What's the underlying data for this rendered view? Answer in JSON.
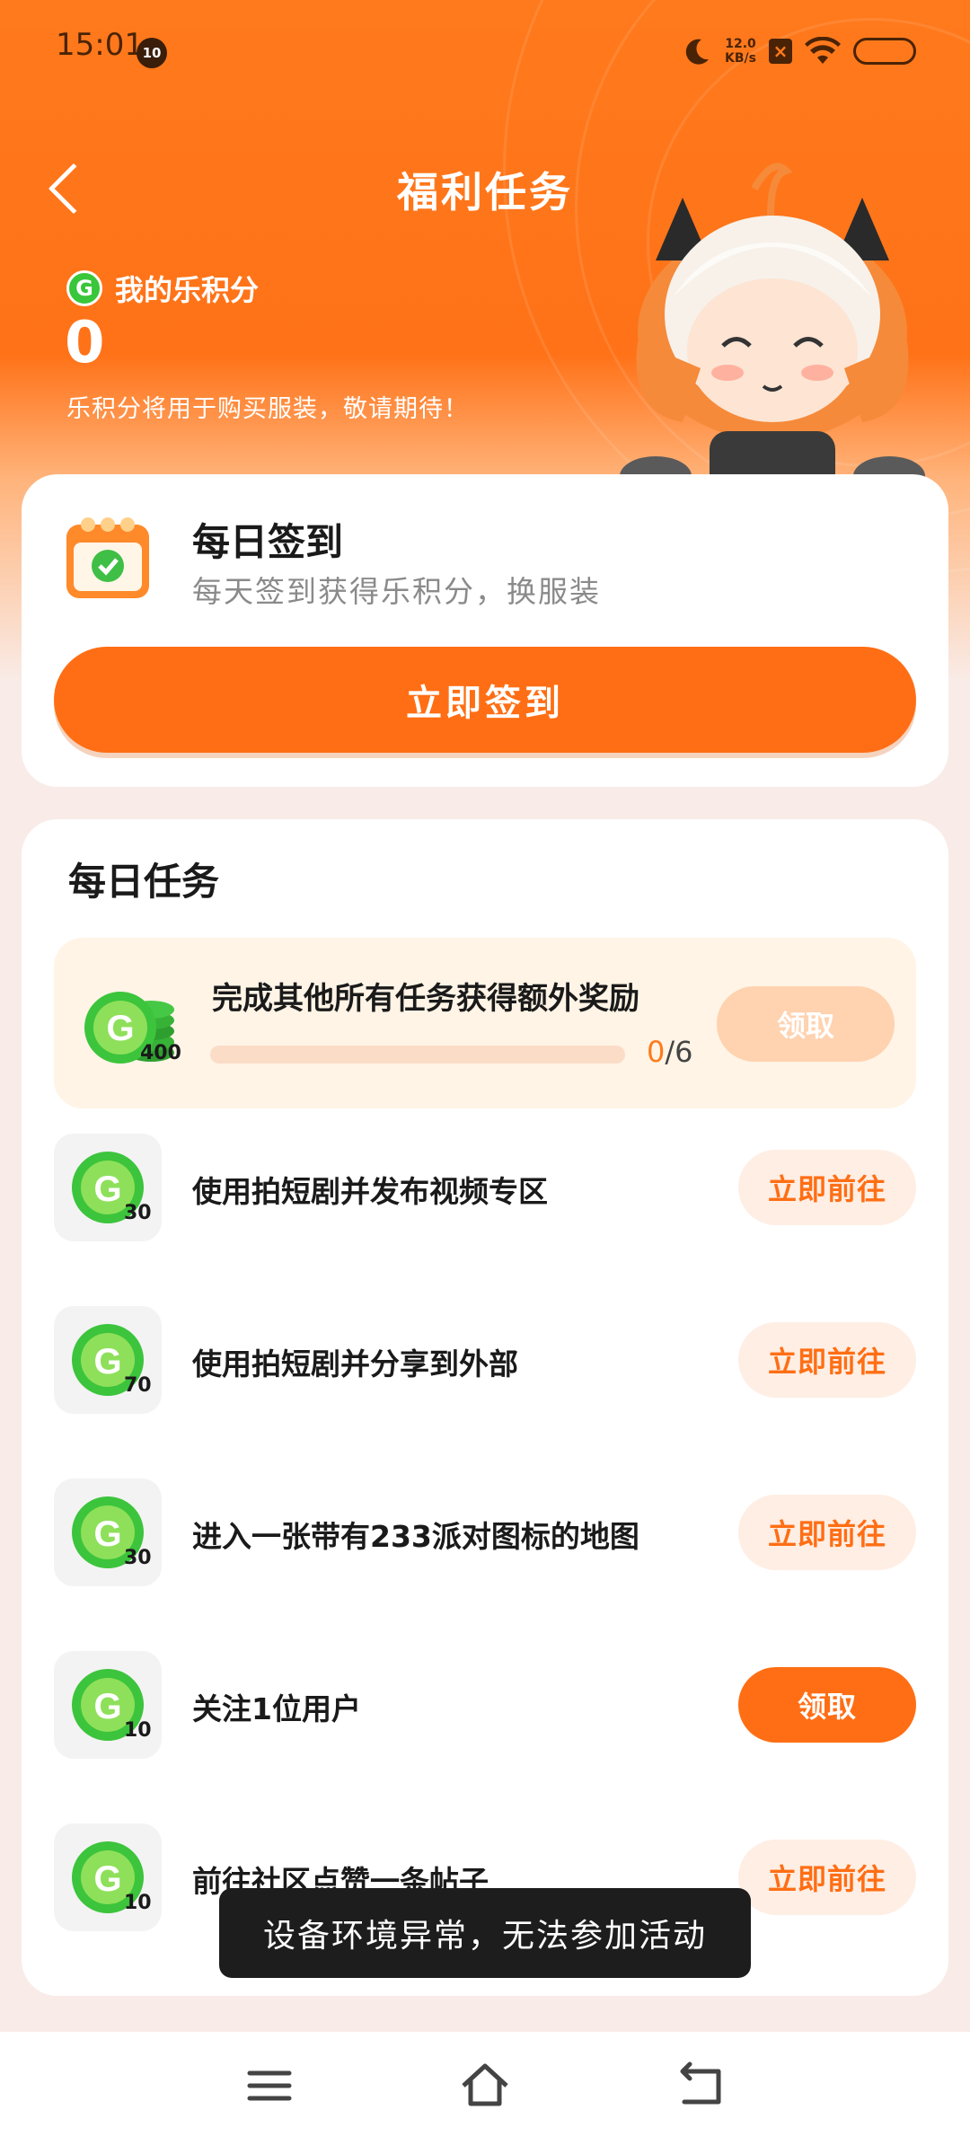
{
  "status_bar": {
    "time": "15:01",
    "notification_count": "10",
    "net_speed_value": "12.0",
    "net_speed_unit": "KB/s",
    "battery_icon": "battery-icon",
    "wifi_icon": "wifi-icon",
    "moon_icon": "moon-icon"
  },
  "header": {
    "title": "福利任务",
    "back_icon": "back-arrow-icon"
  },
  "points": {
    "label": "我的乐积分",
    "value": "0",
    "note": "乐积分将用于购买服装，敬请期待！",
    "coin_glyph": "G"
  },
  "signin": {
    "title": "每日签到",
    "subtitle": "每天签到获得乐积分，换服装",
    "button": "立即签到"
  },
  "daily": {
    "title": "每日任务",
    "bonus": {
      "label": "完成其他所有任务获得额外奖励",
      "points": "400",
      "progress_current": "0",
      "progress_total": "/6",
      "progress_fraction": 0,
      "button": "领取"
    },
    "tasks": [
      {
        "label": "使用拍短剧并发布视频专区",
        "points": "30",
        "button": "立即前往",
        "state": "go"
      },
      {
        "label": "使用拍短剧并分享到外部",
        "points": "70",
        "button": "立即前往",
        "state": "go"
      },
      {
        "label": "进入一张带有233派对图标的地图",
        "points": "30",
        "button": "立即前往",
        "state": "go"
      },
      {
        "label": "关注1位用户",
        "points": "10",
        "button": "领取",
        "state": "claim"
      },
      {
        "label": "前往社区点赞一条帖子",
        "points": "10",
        "button": "立即前往",
        "state": "go"
      }
    ]
  },
  "toast": "设备环境异常，无法参加活动",
  "colors": {
    "accent": "#ff6e14",
    "coin_green": "#39c63a",
    "bonus_bg": "#fff4e6"
  }
}
